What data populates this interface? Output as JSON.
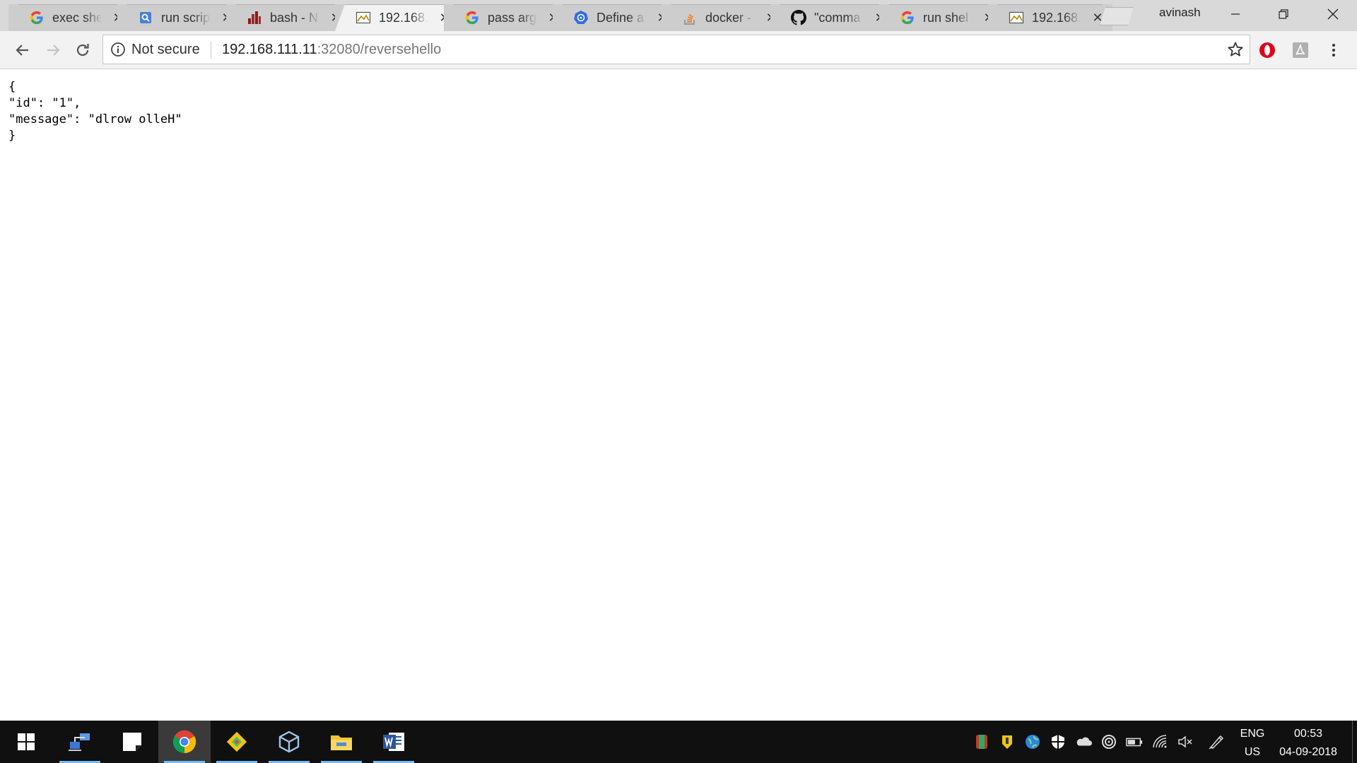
{
  "browser": {
    "tabs": [
      {
        "title": "exec shell",
        "favicon": "google-g-icon"
      },
      {
        "title": "run script",
        "favicon": "search-results-icon"
      },
      {
        "title": "bash - N",
        "favicon": "bars-site-icon"
      },
      {
        "title": "192.168.",
        "favicon": "page-thumbnail-icon",
        "active": true
      },
      {
        "title": "pass arg",
        "favicon": "google-g-icon"
      },
      {
        "title": "Define a",
        "favicon": "kubernetes-icon"
      },
      {
        "title": "docker -",
        "favicon": "stackoverflow-icon"
      },
      {
        "title": "\"comma",
        "favicon": "github-icon"
      },
      {
        "title": "run shel",
        "favicon": "google-g-icon"
      },
      {
        "title": "192.168.",
        "favicon": "page-thumbnail-icon"
      }
    ],
    "profile_name": "avinash",
    "omnibox": {
      "security_label": "Not secure",
      "url_host": "192.168.111.11",
      "url_rest": ":32080/reversehello"
    }
  },
  "page": {
    "json_lines": [
      "{",
      "\"id\": \"1\",",
      "\"message\": \"dlrow olleH\"",
      "}"
    ]
  },
  "taskbar": {
    "apps": [
      "network-icon",
      "sticky-notes-icon",
      "chrome-icon",
      "git-icon",
      "virtualbox-icon",
      "file-explorer-icon",
      "word-icon"
    ],
    "tray_icons": [
      "antivirus-icon",
      "shield-badge-icon",
      "globe-icon",
      "security-icon",
      "onedrive-icon",
      "sync-icon",
      "battery-icon",
      "wifi-icon",
      "volume-muted-icon",
      "pen-icon"
    ],
    "language": "ENG",
    "region": "US",
    "time": "00:53",
    "date": "04-09-2018"
  },
  "colors": {
    "tabstrip": "#d9d9d9",
    "active_tab": "#f2f2f2",
    "taskbar": "#101010",
    "opera_red": "#e0001a",
    "running_indicator": "#76b9ed"
  }
}
